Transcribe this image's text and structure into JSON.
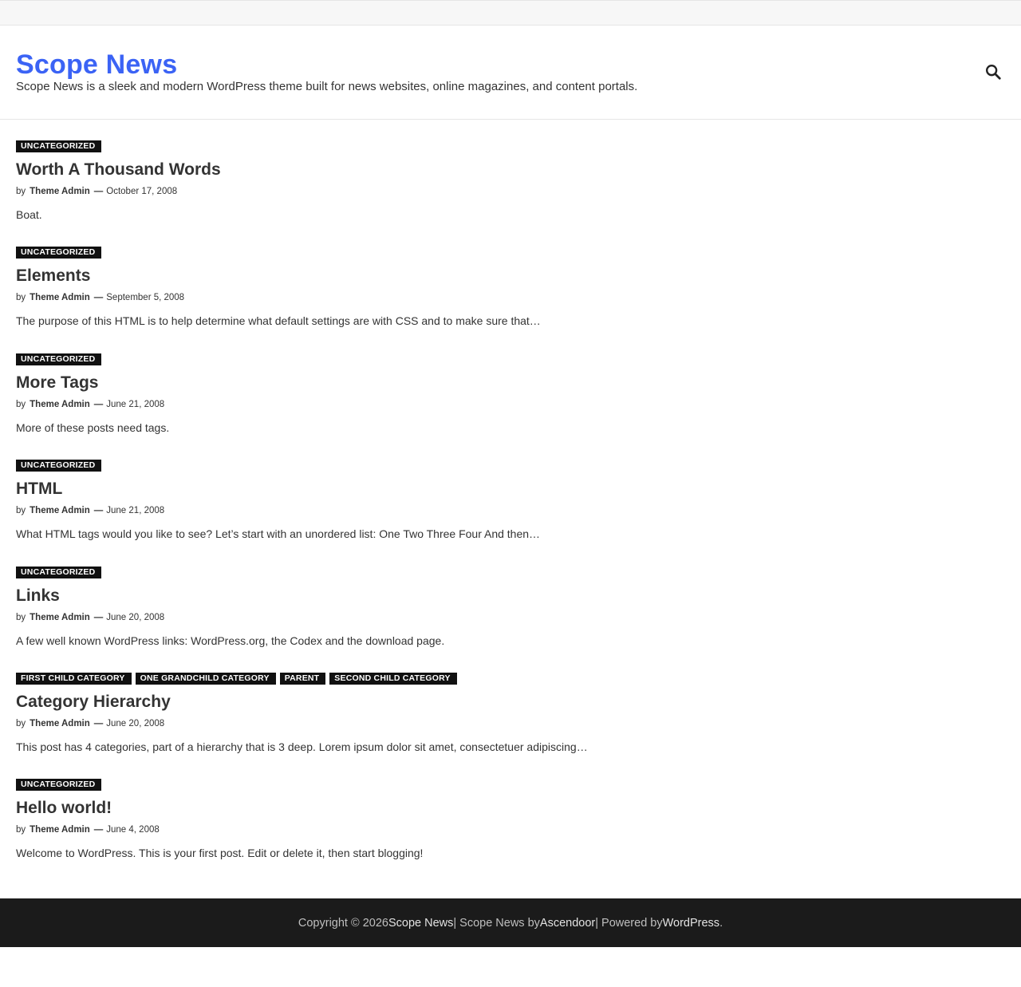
{
  "site": {
    "title": "Scope News",
    "description": "Scope News is a sleek and modern WordPress theme built for news websites, online magazines, and content portals."
  },
  "search": {
    "icon": "search-icon"
  },
  "meta_labels": {
    "by": "by",
    "dash": "—"
  },
  "posts": [
    {
      "categories": [
        "Uncategorized"
      ],
      "title": "Worth A Thousand Words",
      "author": "Theme Admin",
      "date": "October 17, 2008",
      "excerpt": "Boat."
    },
    {
      "categories": [
        "Uncategorized"
      ],
      "title": "Elements",
      "author": "Theme Admin",
      "date": "September 5, 2008",
      "excerpt": "The purpose of this HTML is to help determine what default settings are with CSS and to make sure that…"
    },
    {
      "categories": [
        "Uncategorized"
      ],
      "title": "More Tags",
      "author": "Theme Admin",
      "date": "June 21, 2008",
      "excerpt": "More of these posts need tags."
    },
    {
      "categories": [
        "Uncategorized"
      ],
      "title": "HTML",
      "author": "Theme Admin",
      "date": "June 21, 2008",
      "excerpt": "What HTML tags would you like to see? Let’s start with an unordered list: One Two Three Four And then…"
    },
    {
      "categories": [
        "Uncategorized"
      ],
      "title": "Links",
      "author": "Theme Admin",
      "date": "June 20, 2008",
      "excerpt": "A few well known WordPress links: WordPress.org, the Codex and the download page."
    },
    {
      "categories": [
        "First Child Category",
        "One Grandchild Category",
        "Parent",
        "Second Child Category"
      ],
      "title": "Category Hierarchy",
      "author": "Theme Admin",
      "date": "June 20, 2008",
      "excerpt": "This post has 4 categories, part of a hierarchy that is 3 deep. Lorem ipsum dolor sit amet, consectetuer adipiscing…"
    },
    {
      "categories": [
        "Uncategorized"
      ],
      "title": "Hello world!",
      "author": "Theme Admin",
      "date": "June 4, 2008",
      "excerpt": "Welcome to WordPress. This is your first post. Edit or delete it, then start blogging!"
    }
  ],
  "footer": {
    "prefix": "Copyright © 2026 ",
    "site_link": "Scope News",
    "sep1": " | Scope News by ",
    "theme_author": "Ascendoor",
    "sep2": " | Powered by ",
    "wp_link": "WordPress",
    "suffix": "."
  },
  "colors": {
    "accent": "#3b63f5",
    "category_bg": "#111111",
    "footer_bg": "#1b1b1b"
  }
}
